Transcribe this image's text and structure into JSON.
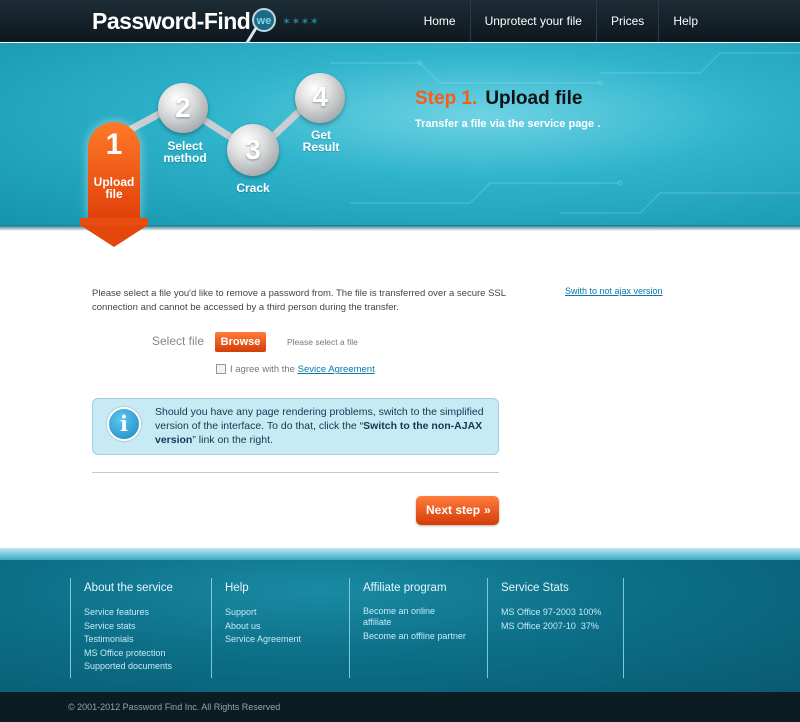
{
  "header": {
    "logo_text": "Password-Find",
    "logo_mark_text": "we",
    "nav": [
      "Home",
      "Unprotect your file",
      "Prices",
      "Help"
    ]
  },
  "steps": {
    "active": {
      "number": "1",
      "label_line1": "Upload",
      "label_line2": "file"
    },
    "items": [
      {
        "number": "2",
        "label_line1": "Select",
        "label_line2": "method"
      },
      {
        "number": "3",
        "label_line1": "Crack",
        "label_line2": ""
      },
      {
        "number": "4",
        "label_line1": "Get",
        "label_line2": "Result"
      }
    ],
    "title_number": "Step 1.",
    "title_name": "Upload file",
    "subtitle": "Transfer a file via the service page ."
  },
  "main": {
    "intro": "Please select a file you'd like to remove a password from. The file is transferred over a secure SSL connection and cannot be accessed by a third person during the transfer.",
    "switch_link": "Swith to not ajax version",
    "select_label": "Select file",
    "browse_button": "Browse",
    "file_hint": "Please select a file",
    "agree_text": "I agree with the",
    "agree_link": "Sevice Agreement",
    "agree_checked": false,
    "info_text_1": "Should you have any page rendering problems, switch to the simplified version of the interface. To do that, click the “",
    "info_text_bold": "Switch to the non-AJAX version",
    "info_text_2": "” link on the right.",
    "next_button": "Next step",
    "next_chevron": "»"
  },
  "footer": {
    "columns": [
      {
        "title": "About the service",
        "links": [
          "Service features",
          "Service stats",
          "Testimonials",
          "MS Office protection",
          "Supported documents"
        ]
      },
      {
        "title": "Help",
        "links": [
          "Support",
          "About us",
          "Service Agreement"
        ]
      },
      {
        "title": "Affiliate program",
        "links": [
          "Become an online affiliate",
          "Become an offline partner"
        ]
      },
      {
        "title": "Service Stats",
        "links": [
          "MS Office 97-2003 100%",
          "MS Office 2007-10  37%"
        ]
      }
    ],
    "copyright": "© 2001-2012 Password Find Inc. All Rights Reserved"
  },
  "colors": {
    "accent_orange": "#ff5a14",
    "hero_teal": "#2fb4cc",
    "footer_teal": "#0d6f88",
    "link_blue": "#0a78a8"
  }
}
